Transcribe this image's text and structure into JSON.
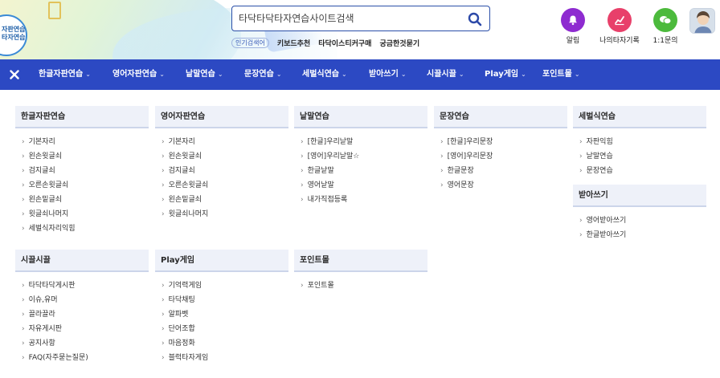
{
  "header": {
    "logo_text": [
      "자판연습",
      "타자연습"
    ],
    "search": {
      "placeholder": "타닥타닥타자연습사이트검색"
    },
    "popular_tag": "인기검색어",
    "popular_links": [
      "키보드추천",
      "타닥이스티커구매",
      "궁금한것묻기"
    ],
    "utilities": [
      {
        "label": "알림",
        "icon": "bell-icon",
        "color": "#8e2bd0"
      },
      {
        "label": "나의타자기록",
        "icon": "chart-icon",
        "color": "#e8406a"
      },
      {
        "label": "1:1문의",
        "icon": "chat-icon",
        "color": "#4cba3c"
      }
    ]
  },
  "nav": {
    "close_icon": "close-icon",
    "items": [
      {
        "label": "한글자판연습",
        "chevron": "⌄"
      },
      {
        "label": "영어자판연습",
        "chevron": "⌄"
      },
      {
        "label": "낱말연습",
        "chevron": "⌄"
      },
      {
        "label": "문장연습",
        "chevron": "⌄"
      },
      {
        "label": "세벌식연습",
        "chevron": "⌄"
      },
      {
        "label": "받아쓰기",
        "chevron": "⌄"
      },
      {
        "label": "시끌시끌",
        "chevron": "⌄"
      },
      {
        "label": "Play게임",
        "chevron": "⌄"
      },
      {
        "label": "포인트몰",
        "chevron": "⌄"
      }
    ]
  },
  "menu": {
    "korean": {
      "title": "한글자판연습",
      "items": [
        "기본자리",
        "왼손윗글쇠",
        "검지글쇠",
        "오른손윗글쇠",
        "왼손밑글쇠",
        "윗글쇠나머지",
        "세벌식자리익힘"
      ]
    },
    "english": {
      "title": "영어자판연습",
      "items": [
        "기본자리",
        "왼손윗글쇠",
        "검지글쇠",
        "오른손윗글쇠",
        "왼손밑글쇠",
        "윗글쇠나머지"
      ]
    },
    "words": {
      "title": "낱말연습",
      "items": [
        "[한글]우리낱말",
        "[영어]우리낱말☆",
        "한글낱말",
        "영어낱말",
        "내가직접등록"
      ]
    },
    "sentences": {
      "title": "문장연습",
      "items": [
        "[한글]우리문장",
        "[영어]우리문장",
        "한글문장",
        "영어문장"
      ]
    },
    "sebeolsik": {
      "title": "세벌식연습",
      "items": [
        "자판익힘",
        "낱말연습",
        "문장연습"
      ]
    },
    "dictation": {
      "title": "받아쓰기",
      "items": [
        "영어받아쓰기",
        "한글받아쓰기"
      ]
    },
    "community": {
      "title": "시끌시끌",
      "items": [
        "타닥타닥게시판",
        "이슈,유머",
        "끌라끌라",
        "자유게시판",
        "공지사항",
        "FAQ(자주묻는질문)"
      ]
    },
    "games": {
      "title": "Play게임",
      "items": [
        "기억력게임",
        "타닥채팅",
        "알파벳",
        "단어조합",
        "마음정화",
        "블럭타자게임"
      ]
    },
    "points": {
      "title": "포인트몰",
      "items": [
        "포인트몰"
      ]
    }
  }
}
